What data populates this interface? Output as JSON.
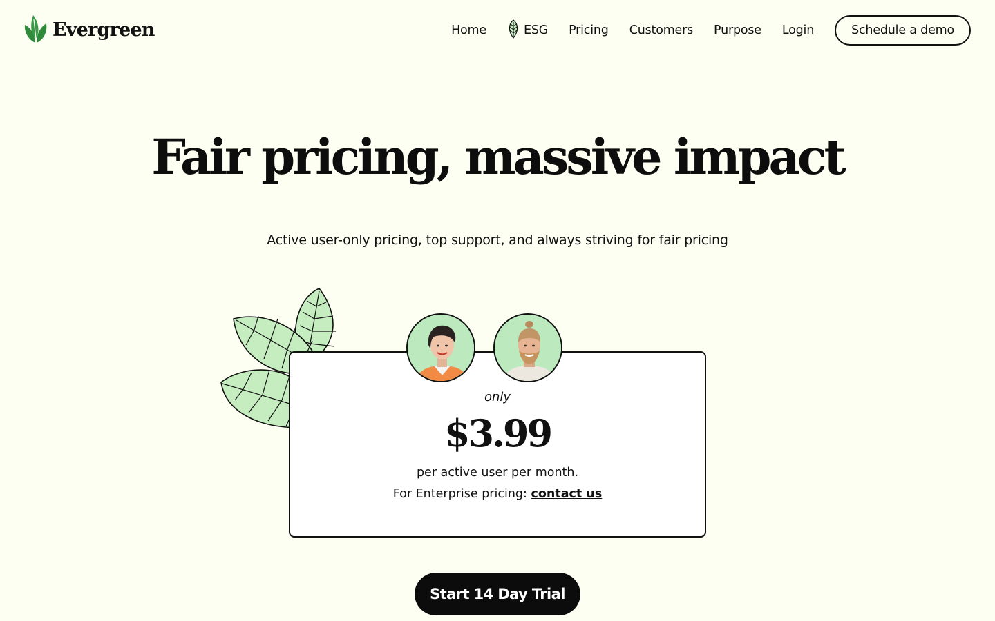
{
  "brand": {
    "name": "Evergreen",
    "logo_icon": "evergreen-leaf-icon",
    "accent": "#2f8a3b"
  },
  "nav": {
    "items": [
      {
        "label": "Home"
      },
      {
        "label": "ESG",
        "icon": "leaf-icon"
      },
      {
        "label": "Pricing"
      },
      {
        "label": "Customers"
      },
      {
        "label": "Purpose"
      },
      {
        "label": "Login"
      }
    ],
    "cta_label": "Schedule a demo"
  },
  "hero": {
    "title": "Fair pricing, massive impact",
    "subtitle": "Active user-only pricing, top support, and always striving for fair pricing"
  },
  "pricing": {
    "prefix": "only",
    "price": "$3.99",
    "unit": "per active user per month.",
    "enterprise_text": "For Enterprise pricing:",
    "enterprise_link": "contact us",
    "leaf_color": "#c5edc0"
  },
  "cta": {
    "trial_label": "Start 14 Day Trial"
  },
  "colors": {
    "background": "#fefff3",
    "ink": "#111111",
    "avatar_bg": "#bde9bf"
  }
}
